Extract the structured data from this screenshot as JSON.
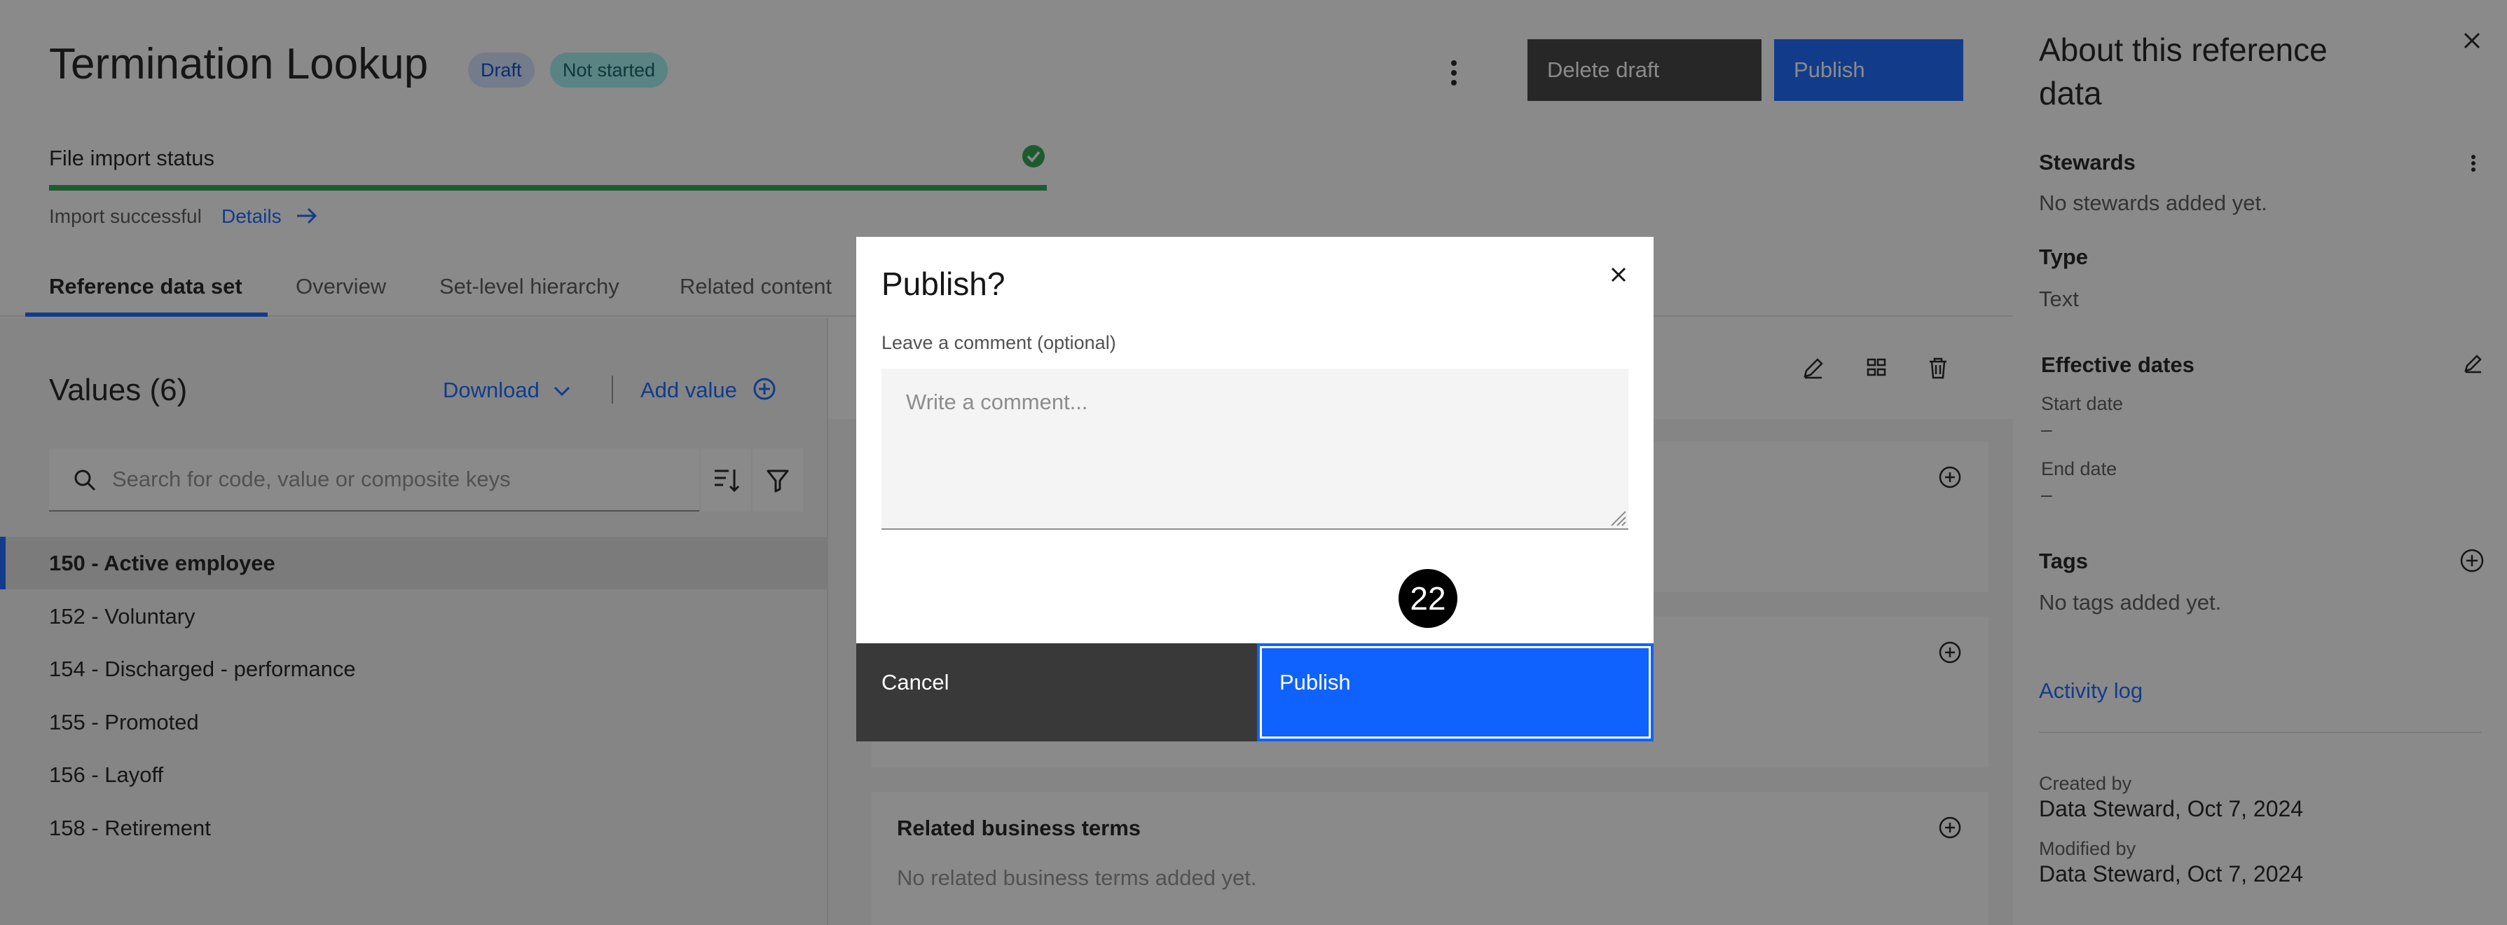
{
  "header": {
    "title": "Termination Lookup",
    "tags": {
      "draft": "Draft",
      "status": "Not started"
    },
    "buttons": {
      "delete_draft": "Delete draft",
      "publish": "Publish"
    },
    "file_import": {
      "label": "File import status",
      "progress_fraction": 1.0,
      "status": "Import successful",
      "details_link": "Details"
    },
    "tabs": [
      {
        "label": "Reference data set"
      },
      {
        "label": "Overview"
      },
      {
        "label": "Set-level hierarchy"
      },
      {
        "label": "Related content"
      }
    ]
  },
  "values_panel": {
    "title": "Values (6)",
    "download_label": "Download",
    "add_value_label": "Add value",
    "search_placeholder": "Search for code, value or composite keys",
    "rows": [
      {
        "label": "150 - Active employee"
      },
      {
        "label": "152 - Voluntary"
      },
      {
        "label": "154 - Discharged - performance"
      },
      {
        "label": "155 - Promoted"
      },
      {
        "label": "156 - Layoff"
      },
      {
        "label": "158 - Retirement"
      }
    ]
  },
  "detail_panel": {
    "related_terms_title": "Related business terms",
    "related_terms_empty": "No related business terms added yet."
  },
  "side_panel": {
    "title": "About this reference data",
    "stewards_label": "Stewards",
    "stewards_value": "No stewards added yet.",
    "type_label": "Type",
    "type_value": "Text",
    "effective_dates_label": "Effective dates",
    "start_date_label": "Start date",
    "start_date_value": "–",
    "end_date_label": "End date",
    "end_date_value": "–",
    "tags_label": "Tags",
    "tags_value": "No tags added yet.",
    "activity_log": "Activity log",
    "created_by_label": "Created by",
    "created_by_value": "Data Steward, Oct 7, 2024",
    "modified_by_label": "Modified by",
    "modified_by_value": "Data Steward, Oct 7, 2024"
  },
  "modal": {
    "title": "Publish?",
    "comment_label": "Leave a comment (optional)",
    "comment_placeholder": "Write a comment...",
    "cancel_label": "Cancel",
    "publish_label": "Publish",
    "step_badge": "22"
  },
  "colors": {
    "primary": "#0f62fe",
    "success": "#24a148",
    "dark_button": "#393939"
  }
}
